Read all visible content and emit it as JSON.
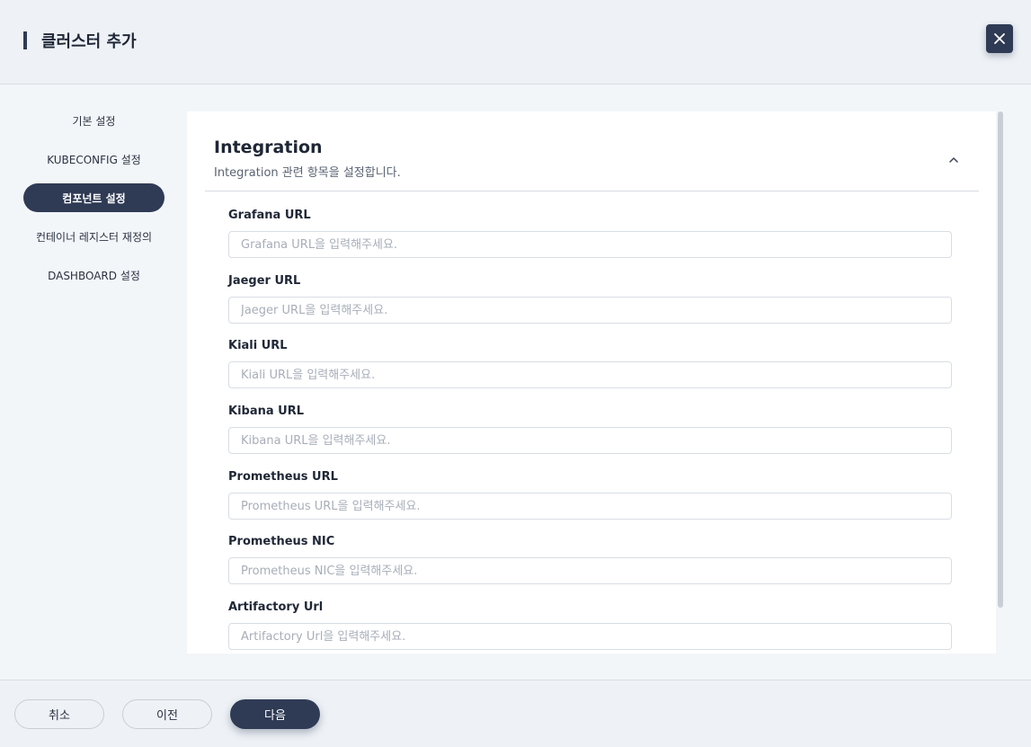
{
  "header": {
    "title": "클러스터 추가",
    "close_icon": "close-icon"
  },
  "sidebar": {
    "items": [
      {
        "label": "기본 설정"
      },
      {
        "label": "KUBECONFIG 설정"
      },
      {
        "label": "컴포넌트 설정",
        "active": true
      },
      {
        "label": "컨테이너 레지스터 재정의"
      },
      {
        "label": "DASHBOARD 설정"
      }
    ]
  },
  "section": {
    "title": "Integration",
    "subtitle": "Integration 관련 항목을 설정합니다.",
    "collapse_icon": "chevron-up-icon",
    "fields": [
      {
        "label": "Grafana URL",
        "placeholder": "Grafana URL을 입력해주세요.",
        "value": ""
      },
      {
        "label": "Jaeger URL",
        "placeholder": "Jaeger URL을 입력해주세요.",
        "value": ""
      },
      {
        "label": "Kiali URL",
        "placeholder": "Kiali URL을 입력해주세요.",
        "value": ""
      },
      {
        "label": "Kibana URL",
        "placeholder": "Kibana URL을 입력해주세요.",
        "value": ""
      },
      {
        "label": "Prometheus URL",
        "placeholder": "Prometheus URL을 입력해주세요.",
        "value": ""
      },
      {
        "label": "Prometheus NIC",
        "placeholder": "Prometheus NIC을 입력해주세요.",
        "value": ""
      },
      {
        "label": "Artifactory Url",
        "placeholder": "Artifactory Url을 입력해주세요.",
        "value": ""
      }
    ]
  },
  "footer": {
    "cancel_label": "취소",
    "prev_label": "이전",
    "next_label": "다음"
  },
  "colors": {
    "accent": "#2f3b55",
    "background": "#f3f6f9",
    "panel": "#ffffff"
  }
}
